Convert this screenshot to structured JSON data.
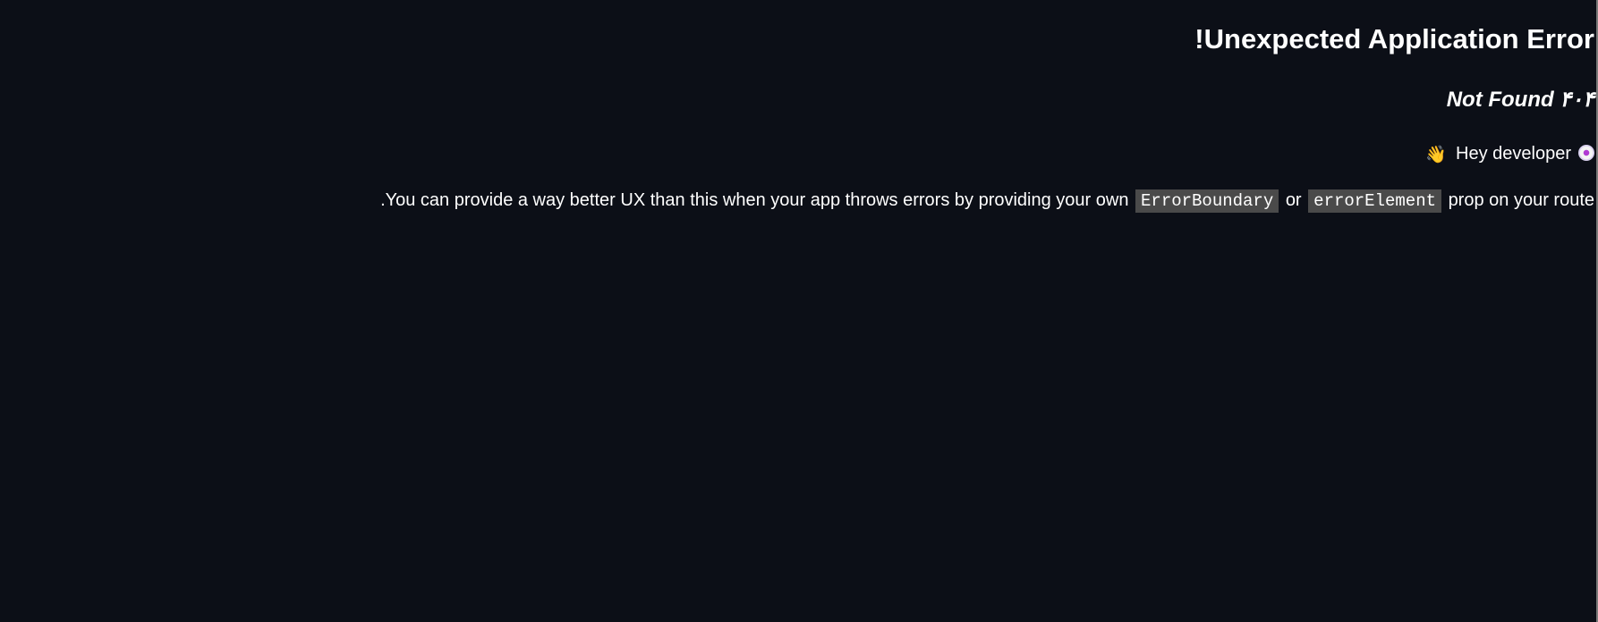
{
  "error": {
    "title": "!Unexpected Application Error",
    "status": "Not Found ۴۰۴",
    "developer_text": "Hey developer",
    "hint_before": ".You can provide a way better UX than this when your app throws errors by providing your own",
    "code_boundary": "ErrorBoundary",
    "connector": "or",
    "code_element": "errorElement",
    "hint_after": "prop on your route"
  },
  "icons": {
    "wave": "waving-hand-icon",
    "disc": "disc-icon"
  },
  "colors": {
    "background": "#0c0f17",
    "text": "#ffffff",
    "code_bg": "#4a4a4a"
  }
}
